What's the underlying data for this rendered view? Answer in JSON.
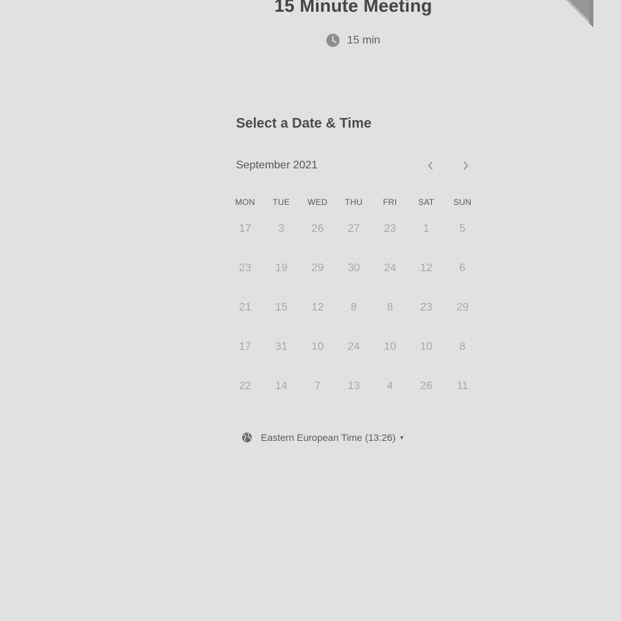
{
  "event": {
    "title": "15 Minute Meeting",
    "duration": "15 min",
    "duration_icon": "clock-icon"
  },
  "scheduler": {
    "title": "Select a Date & Time",
    "month_label": "September 2021",
    "prev_icon": "chevron-left-icon",
    "next_icon": "chevron-right-icon",
    "weekdays": [
      "MON",
      "TUE",
      "WED",
      "THU",
      "FRI",
      "SAT",
      "SUN"
    ],
    "weeks": [
      [
        "17",
        "3",
        "26",
        "27",
        "23",
        "1",
        "5"
      ],
      [
        "23",
        "19",
        "29",
        "30",
        "24",
        "12",
        "6"
      ],
      [
        "21",
        "15",
        "12",
        "8",
        "8",
        "23",
        "29"
      ],
      [
        "17",
        "31",
        "10",
        "24",
        "10",
        "10",
        "8"
      ],
      [
        "22",
        "14",
        "7",
        "13",
        "4",
        "26",
        "11"
      ]
    ]
  },
  "timezone": {
    "label": "Eastern European Time (13:26)",
    "icon": "globe-icon"
  },
  "colors": {
    "background": "#e1e1e1",
    "text": "#4a4a4a",
    "muted_day": "#a9a9a9"
  }
}
